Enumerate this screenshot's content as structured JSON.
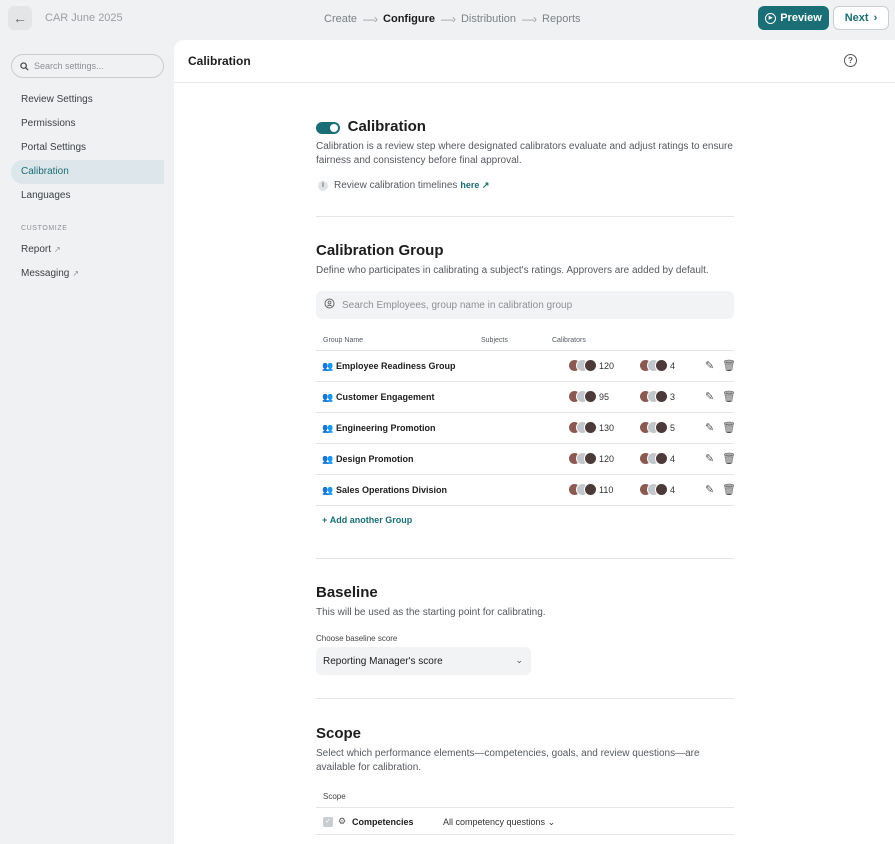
{
  "header": {
    "back_icon": "arrow-left-icon",
    "app_title": "CAR June 2025",
    "steps": [
      {
        "label": "Create",
        "active": false
      },
      {
        "label": "Configure",
        "active": true
      },
      {
        "label": "Distribution",
        "active": false
      },
      {
        "label": "Reports",
        "active": false
      }
    ],
    "preview_label": "Preview",
    "next_label": "Next"
  },
  "sidebar": {
    "search_placeholder": "Search settings...",
    "items": [
      {
        "label": "Review Settings",
        "active": false
      },
      {
        "label": "Permissions",
        "active": false
      },
      {
        "label": "Portal Settings",
        "active": false
      },
      {
        "label": "Calibration",
        "active": true
      },
      {
        "label": "Languages",
        "active": false
      }
    ],
    "customize_heading": "CUSTOMIZE",
    "customize_items": [
      {
        "label": "Report"
      },
      {
        "label": "Messaging"
      }
    ]
  },
  "panel": {
    "title": "Calibration"
  },
  "calibration": {
    "title": "Calibration",
    "enabled": true,
    "description": "Calibration is a review step where designated calibrators evaluate and adjust ratings to ensure fairness and consistency before final approval.",
    "timeline_text": "Review calibration timelines",
    "timeline_link": "here"
  },
  "calibration_group": {
    "title": "Calibration Group",
    "description": "Define who participates in calibrating a subject's ratings. Approvers are added by default.",
    "search_placeholder": "Search Employees, group name in calibration group",
    "columns": {
      "name": "Group Name",
      "subjects": "Subjects",
      "calibrators": "Calibrators"
    },
    "rows": [
      {
        "name": "Employee Readiness Group",
        "subjects": "120",
        "calibrators": "4"
      },
      {
        "name": "Customer Engagement",
        "subjects": "95",
        "calibrators": "3"
      },
      {
        "name": "Engineering Promotion",
        "subjects": "130",
        "calibrators": "5"
      },
      {
        "name": "Design Promotion",
        "subjects": "120",
        "calibrators": "4"
      },
      {
        "name": "Sales Operations Division",
        "subjects": "110",
        "calibrators": "4"
      }
    ],
    "add_label": "Add another Group"
  },
  "baseline": {
    "title": "Baseline",
    "description": "This will be used as the starting point for calibrating.",
    "select_label": "Choose baseline score",
    "select_value": "Reporting Manager's score"
  },
  "scope": {
    "title": "Scope",
    "description": "Select which performance elements—competencies, goals, and review questions—are available for calibration.",
    "column": "Scope",
    "rows": [
      {
        "name": "Competencies",
        "value": "All competency questions",
        "checked": true
      }
    ]
  },
  "colors": {
    "accent": "#1a6e75",
    "sidebar_active_bg": "#dde6ea"
  }
}
